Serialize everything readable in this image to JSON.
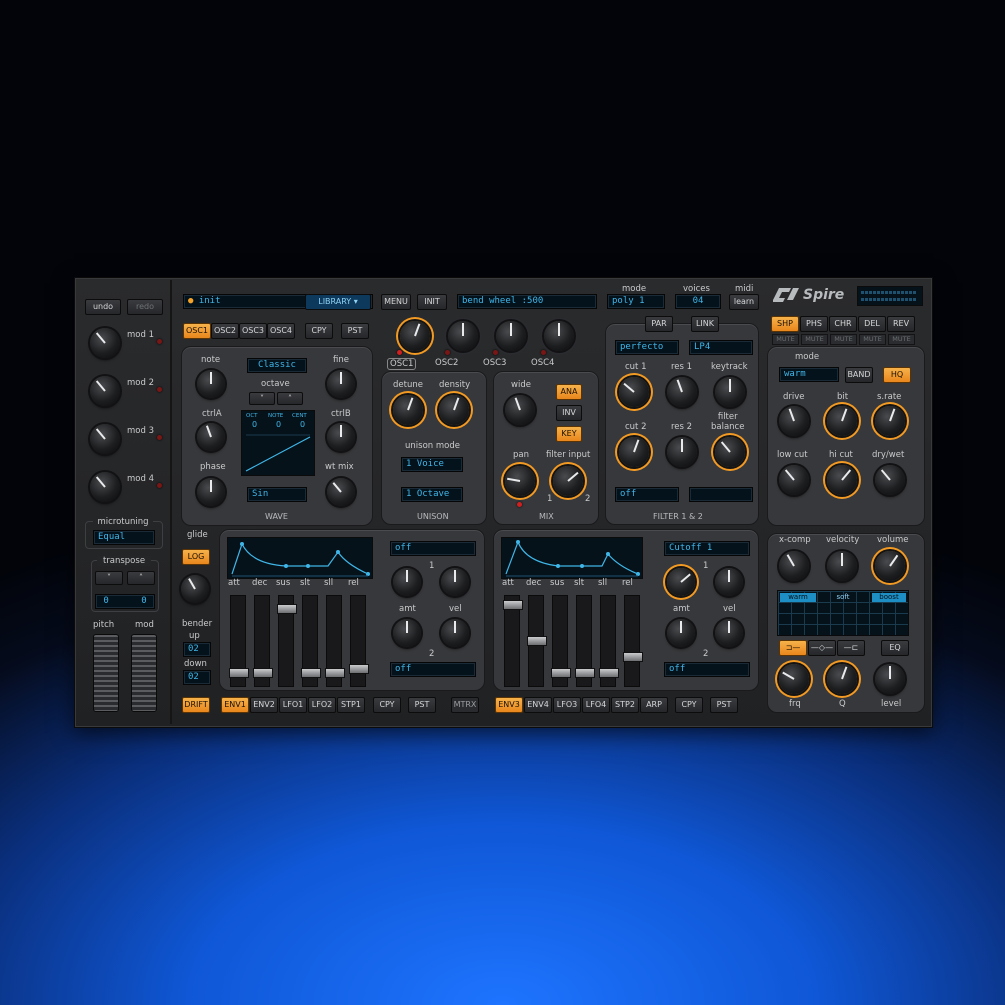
{
  "header": {
    "undo": "undo",
    "redo": "redo",
    "preset_name": "init",
    "library": "LIBRARY",
    "menu": "MENU",
    "init": "INIT",
    "bend_display": "bend wheel  :500",
    "mode_label": "mode",
    "mode_value": "poly 1",
    "voices_label": "voices",
    "voices_value": "04",
    "midi_label": "midi",
    "midi_value": "learn",
    "logo": "Spire"
  },
  "left": {
    "mods": [
      "mod 1",
      "mod 2",
      "mod 3",
      "mod 4"
    ],
    "microtuning_label": "microtuning",
    "microtuning_value": "Equal",
    "transpose_label": "transpose",
    "transpose_values": [
      "0",
      "0"
    ],
    "pitch": "pitch",
    "mod": "mod"
  },
  "osc": {
    "tabs": [
      "OSC1",
      "OSC2",
      "OSC3",
      "OSC4"
    ],
    "cpy": "CPY",
    "pst": "PST",
    "note": "note",
    "fine": "fine",
    "mode_value": "Classic",
    "octave": "octave",
    "ctrla": "ctrlA",
    "ctrlb": "ctrlB",
    "phase": "phase",
    "wt_mix": "wt mix",
    "oct_hdr": "OCT",
    "note_hdr": "NOTE",
    "cent_hdr": "CENT",
    "oct_val": "0",
    "note_val": "0",
    "cent_val": "0",
    "wave_value": "Sin",
    "wave_section": "WAVE",
    "top_labels": [
      "OSC1",
      "OSC2",
      "OSC3",
      "OSC4"
    ]
  },
  "unison": {
    "detune": "detune",
    "density": "density",
    "mode_label": "unison mode",
    "voice": "1 Voice",
    "octave": "1 Octave",
    "section": "UNISON"
  },
  "mix": {
    "wide": "wide",
    "ana": "ANA",
    "inv": "INV",
    "key": "KEY",
    "pan": "pan",
    "filter_input": "filter input",
    "n1": "1",
    "n2": "2",
    "section": "MIX"
  },
  "filter": {
    "par": "PAR",
    "link": "LINK",
    "type1": "perfecto",
    "type2": "LP4",
    "cut1": "cut 1",
    "res1": "res 1",
    "keytrack": "keytrack",
    "cut2": "cut 2",
    "res2": "res 2",
    "balance": "filter\nbalance",
    "off1": "off",
    "section": "FILTER 1 & 2"
  },
  "fx": {
    "tabs": [
      "SHP",
      "PHS",
      "CHR",
      "DEL",
      "REV"
    ],
    "mutes": [
      "MUTE",
      "MUTE",
      "MUTE",
      "MUTE",
      "MUTE"
    ],
    "mode_label": "mode",
    "mode_value": "warm",
    "band": "BAND",
    "hq": "HQ",
    "drive": "drive",
    "bit": "bit",
    "srate": "s.rate",
    "low_cut": "low cut",
    "hi_cut": "hi cut",
    "dry_wet": "dry/wet"
  },
  "glide": {
    "label": "glide",
    "log": "LOG",
    "bender": "bender",
    "up": "up",
    "up_val": "02",
    "down": "down",
    "down_val": "02"
  },
  "env1": {
    "labels": [
      "att",
      "dec",
      "sus",
      "slt",
      "sll",
      "rel"
    ],
    "dest1": "off",
    "dest2": "off",
    "amt": "amt",
    "vel": "vel",
    "n1": "1",
    "n2": "2",
    "tabs": [
      "ENV1",
      "ENV2",
      "LFO1",
      "LFO2",
      "STP1"
    ],
    "cpy": "CPY",
    "pst": "PST",
    "drift": "DRIFT",
    "mtrx": "MTRX",
    "fader_levels": [
      0.1,
      0.1,
      0.9,
      0.1,
      0.1,
      0.15
    ]
  },
  "env2": {
    "labels": [
      "att",
      "dec",
      "sus",
      "slt",
      "sll",
      "rel"
    ],
    "dest1": "Cutoff 1",
    "dest2": "off",
    "amt": "amt",
    "vel": "vel",
    "n1": "1",
    "n2": "2",
    "tabs": [
      "ENV3",
      "ENV4",
      "LFO3",
      "LFO4",
      "STP2",
      "ARP"
    ],
    "cpy": "CPY",
    "pst": "PST",
    "fader_levels": [
      0.95,
      0.5,
      0.1,
      0.1,
      0.1,
      0.3
    ]
  },
  "eq": {
    "xcomp": "x-comp",
    "velocity": "velocity",
    "volume": "volume",
    "bands": [
      "warm",
      "soft",
      "boost"
    ],
    "eq": "EQ",
    "frq": "frq",
    "q": "Q",
    "level": "level"
  }
}
